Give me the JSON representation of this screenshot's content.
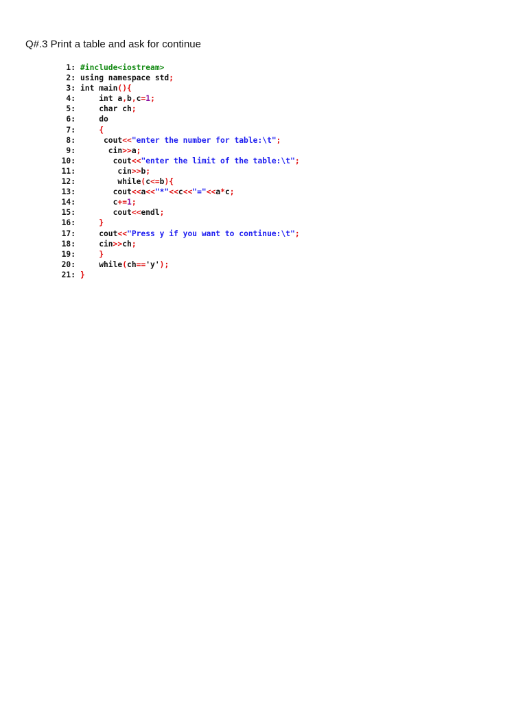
{
  "document": {
    "heading": "Q#.3 Print a table and ask for continue",
    "code_lines": [
      {
        "num": "1:",
        "tokens": [
          [
            "#include<iostream>",
            "g"
          ]
        ]
      },
      {
        "num": "2:",
        "tokens": [
          [
            "using namespace std",
            "k"
          ],
          [
            ";",
            "r"
          ]
        ]
      },
      {
        "num": "3:",
        "tokens": [
          [
            "int main",
            "k"
          ],
          [
            "(){",
            "r"
          ]
        ]
      },
      {
        "num": "4:",
        "tokens": [
          [
            "    int a",
            "k"
          ],
          [
            ",",
            "r"
          ],
          [
            "b",
            "k"
          ],
          [
            ",",
            "r"
          ],
          [
            "c",
            "k"
          ],
          [
            "=",
            "r"
          ],
          [
            "1",
            "n"
          ],
          [
            ";",
            "r"
          ]
        ]
      },
      {
        "num": "5:",
        "tokens": [
          [
            "    char ch",
            "k"
          ],
          [
            ";",
            "r"
          ]
        ]
      },
      {
        "num": "6:",
        "tokens": [
          [
            "    do",
            "k"
          ]
        ]
      },
      {
        "num": "7:",
        "tokens": [
          [
            "    ",
            "k"
          ],
          [
            "{",
            "r"
          ]
        ]
      },
      {
        "num": "8:",
        "tokens": [
          [
            "     cout",
            "k"
          ],
          [
            "<<",
            "r"
          ],
          [
            "\"enter the number for table:\\t\"",
            "s"
          ],
          [
            ";",
            "r"
          ]
        ]
      },
      {
        "num": "9:",
        "tokens": [
          [
            "      cin",
            "k"
          ],
          [
            ">>",
            "r"
          ],
          [
            "a",
            "k"
          ],
          [
            ";",
            "r"
          ]
        ]
      },
      {
        "num": "10:",
        "tokens": [
          [
            "       cout",
            "k"
          ],
          [
            "<<",
            "r"
          ],
          [
            "\"enter the limit of the table:\\t\"",
            "s"
          ],
          [
            ";",
            "r"
          ]
        ]
      },
      {
        "num": "11:",
        "tokens": [
          [
            "        cin",
            "k"
          ],
          [
            ">>",
            "r"
          ],
          [
            "b",
            "k"
          ],
          [
            ";",
            "r"
          ]
        ]
      },
      {
        "num": "12:",
        "tokens": [
          [
            "        while",
            "k"
          ],
          [
            "(",
            "r"
          ],
          [
            "c",
            "k"
          ],
          [
            "<=",
            "r"
          ],
          [
            "b",
            "k"
          ],
          [
            "){",
            "r"
          ]
        ]
      },
      {
        "num": "13:",
        "tokens": [
          [
            "       cout",
            "k"
          ],
          [
            "<<",
            "r"
          ],
          [
            "a",
            "k"
          ],
          [
            "<<",
            "r"
          ],
          [
            "\"*\"",
            "s"
          ],
          [
            "<<",
            "r"
          ],
          [
            "c",
            "k"
          ],
          [
            "<<",
            "r"
          ],
          [
            "\"=\"",
            "s"
          ],
          [
            "<<",
            "r"
          ],
          [
            "a",
            "k"
          ],
          [
            "*",
            "r"
          ],
          [
            "c",
            "k"
          ],
          [
            ";",
            "r"
          ]
        ]
      },
      {
        "num": "14:",
        "tokens": [
          [
            "       c",
            "k"
          ],
          [
            "+=",
            "r"
          ],
          [
            "1",
            "n"
          ],
          [
            ";",
            "r"
          ]
        ]
      },
      {
        "num": "15:",
        "tokens": [
          [
            "       cout",
            "k"
          ],
          [
            "<<",
            "r"
          ],
          [
            "endl",
            "k"
          ],
          [
            ";",
            "r"
          ]
        ]
      },
      {
        "num": "16:",
        "tokens": [
          [
            "    ",
            "k"
          ],
          [
            "}",
            "r"
          ]
        ]
      },
      {
        "num": "17:",
        "tokens": [
          [
            "    cout",
            "k"
          ],
          [
            "<<",
            "r"
          ],
          [
            "\"Press y if you want to continue:\\t\"",
            "s"
          ],
          [
            ";",
            "r"
          ]
        ]
      },
      {
        "num": "18:",
        "tokens": [
          [
            "    cin",
            "k"
          ],
          [
            ">>",
            "r"
          ],
          [
            "ch",
            "k"
          ],
          [
            ";",
            "r"
          ]
        ]
      },
      {
        "num": "19:",
        "tokens": [
          [
            "    ",
            "k"
          ],
          [
            "}",
            "r"
          ]
        ]
      },
      {
        "num": "20:",
        "tokens": [
          [
            "    while",
            "k"
          ],
          [
            "(",
            "r"
          ],
          [
            "ch",
            "k"
          ],
          [
            "==",
            "r"
          ],
          [
            "'y'",
            "k"
          ],
          [
            ");",
            "r"
          ]
        ]
      },
      {
        "num": "21:",
        "tokens": [
          [
            "",
            "k"
          ],
          [
            "}",
            "r"
          ]
        ]
      }
    ]
  }
}
